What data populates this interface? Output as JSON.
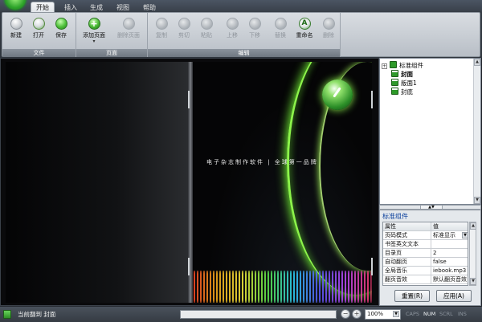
{
  "ribbon": {
    "tabs": [
      "开始",
      "插入",
      "生成",
      "视图",
      "帮助"
    ],
    "groups": {
      "file": {
        "label": "文件",
        "buttons": [
          "新建",
          "打开",
          "保存"
        ]
      },
      "page": {
        "label": "页面",
        "add": "添加页面",
        "delete": "删除页面"
      },
      "edit": {
        "label": "编辑",
        "buttons": [
          "复制",
          "剪切",
          "粘贴",
          "上移",
          "下移",
          "替换",
          "重命名",
          "删除"
        ]
      }
    }
  },
  "canvas": {
    "tagline": "电子杂志制作软件 | 全球第一品牌"
  },
  "tree": {
    "root": "标准组件",
    "items": [
      "封面",
      "版面1",
      "封底"
    ]
  },
  "properties": {
    "title": "标准组件",
    "headers": [
      "属性",
      "值"
    ],
    "rows": [
      {
        "name": "页码模式",
        "value": "标准显示",
        "dropdown": true
      },
      {
        "name": "书签英文文本",
        "value": ""
      },
      {
        "name": "目录页",
        "value": "2"
      },
      {
        "name": "自动翻页",
        "value": "false"
      },
      {
        "name": "全局音乐",
        "value": "iebook.mp3"
      },
      {
        "name": "翻页音效",
        "value": "默认翻页音效"
      }
    ],
    "reset_label": "重置(R)",
    "apply_label": "应用(A)"
  },
  "statusbar": {
    "text": "当前翻到 封面",
    "zoom": "100%",
    "indicators": [
      "CAPS",
      "NUM",
      "SCRL",
      "INS"
    ],
    "active_indicators": [
      "NUM"
    ]
  },
  "colors": {
    "accent_green": "#4fc03a",
    "ribbon_dark": "#3a414b",
    "title_blue": "#0a3f9c"
  }
}
